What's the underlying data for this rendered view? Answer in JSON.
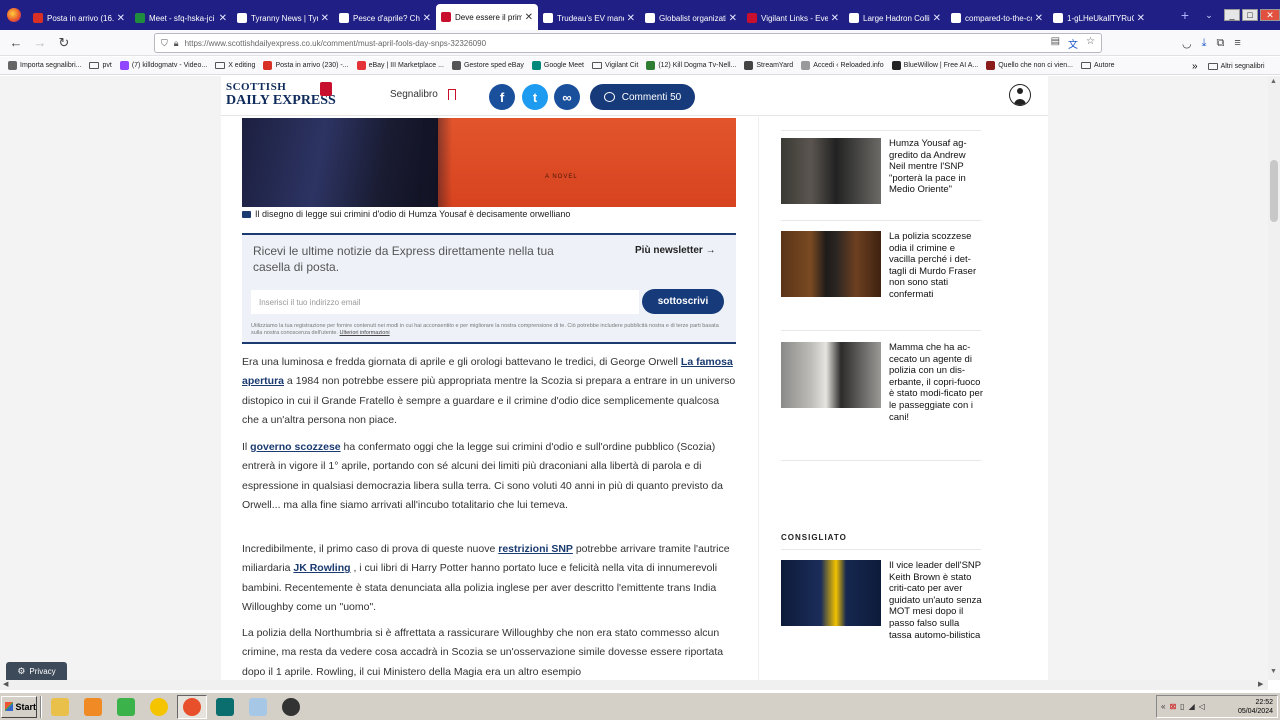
{
  "tabs": [
    {
      "label": "Posta in arrivo (16...)",
      "color": "#d93025"
    },
    {
      "label": "Meet - sfq-hska-jci",
      "color": "#1e8e3e"
    },
    {
      "label": "Tyranny News | Tyranny",
      "color": "#ffffff"
    },
    {
      "label": "Pesce d'aprile? Chiamare",
      "color": "#ffffff"
    },
    {
      "label": "Deve essere il primo",
      "color": "#c8102e",
      "active": true
    },
    {
      "label": "Trudeau's EV mandate c",
      "color": "#ffffff"
    },
    {
      "label": "Globalist organizations a",
      "color": "#ffffff"
    },
    {
      "label": "Vigilant Links - Ever",
      "color": "#c8102e"
    },
    {
      "label": "Large Hadron Collid",
      "color": "#ffffff"
    },
    {
      "label": "compared-to-the-collid",
      "color": "#ffffff"
    },
    {
      "label": "1-gLHeUkallTYRuQIpPal",
      "color": "#ffffff"
    }
  ],
  "window_controls": {
    "minimize": "_",
    "maximize": "□",
    "close": "✕"
  },
  "nav": {
    "url": "https://www.scottishdailyexpress.co.uk/comment/must-april-fools-day-snps-32326090"
  },
  "bookmarks": [
    {
      "label": "Importa segnalibri...",
      "icon": "import-icon",
      "color": "#666666"
    },
    {
      "label": "pvt",
      "icon": "folder-icon"
    },
    {
      "label": "(7) killdogmatv - Video...",
      "icon": "twitch-icon",
      "color": "#9146ff"
    },
    {
      "label": "X editing",
      "icon": "folder-icon"
    },
    {
      "label": "Posta in arrivo (230) -...",
      "icon": "gmail-icon",
      "color": "#d93025"
    },
    {
      "label": "eBay | III Marketplace ...",
      "icon": "ebay-icon",
      "color": "#e53238"
    },
    {
      "label": "Gestore sped eBay",
      "icon": "globe-icon",
      "color": "#555555"
    },
    {
      "label": "Google Meet",
      "icon": "meet-icon",
      "color": "#00897b"
    },
    {
      "label": "Vigilant Cit",
      "icon": "folder-icon"
    },
    {
      "label": "(12) Kill Dogma Tv-Nell...",
      "icon": "youtube-icon",
      "color": "#2e7d32"
    },
    {
      "label": "StreamYard",
      "icon": "streamyard-icon",
      "color": "#444444"
    },
    {
      "label": "Accedi ‹ Reloaded.info",
      "icon": "doc-icon",
      "color": "#999999"
    },
    {
      "label": "BlueWillow | Free AI A...",
      "icon": "bluewillow-icon",
      "color": "#222222"
    },
    {
      "label": "Quello che non ci vien...",
      "icon": "site-icon",
      "color": "#8b1a1a"
    },
    {
      "label": "Autore",
      "icon": "folder-icon"
    }
  ],
  "bookmarks_other": "Altri segnalibri",
  "site": {
    "logo_line1": "SCOTTISH",
    "logo_line2": "DAILY EXPRESS",
    "bookmark_label": "Segnalibro",
    "comments_label": "Commenti 50",
    "share_facebook": "f",
    "share_twitter": "t",
    "share_link": "∞"
  },
  "article": {
    "hero_novel_text": "A NOVEL",
    "caption": "Il disegno di legge sui crimini d'odio di Humza Yousaf è decisamente orwelliano",
    "newsletter": {
      "title": "Ricevi le ultime notizie da Express direttamente nella tua casella di posta.",
      "more": "Più newsletter",
      "placeholder": "Inserisci il tuo indirizzo email",
      "submit": "sottoscrivi",
      "legal": "Utilizziamo la tua registrazione per fornire contenuti nei modi in cui hai acconsentito e per migliorare la nostra comprensione di te. Ciò potrebbe includere pubblicità nostra e di terze parti basata sulla nostra conoscenza dell'utente.",
      "legal_link": "Ulteriori informazioni"
    },
    "p1": {
      "a": "Era una luminosa e fredda giornata di aprile e gli orologi battevano le tredici, di George Orwell ",
      "link": "La famosa apertura",
      "b": " a 1984 non potrebbe essere più appropriata mentre la Scozia si prepara a entrare in un universo distopico in cui il Grande Fratello è sempre a guardare e il crimine d'odio dice semplicemente qualcosa che a un'altra persona non piace."
    },
    "p2": {
      "a": "Il ",
      "link": "governo scozzese",
      "b": " ha confermato oggi che la legge sui crimini d'odio e sull'ordine pubblico (Scozia) entrerà in vigore il 1° aprile, portando con sé alcuni dei limiti più draconiani alla libertà di parola e di espressione in qualsiasi democrazia libera sulla terra. Ci sono voluti 40 anni in più di quanto previsto da Orwell... ma alla fine siamo arrivati all'incubo totalitario che lui temeva."
    },
    "p3": {
      "a": "Incredibilmente, il primo caso di prova di queste nuove ",
      "link1": "restrizioni SNP",
      "b": " potrebbe arrivare tramite l'autrice miliardaria ",
      "link2": "JK Rowling",
      "c": " , i cui libri di Harry Potter hanno portato luce e felicità nella vita di innumerevoli bambini. Recentemente è stata denunciata alla polizia inglese per aver descritto l'emittente trans India Willoughby come un \"uomo\"."
    },
    "p4": "La polizia della Northumbria si è affrettata a rassicurare Willoughby che non era stato commesso alcun crimine, ma resta da vedere cosa accadrà in Scozia se un'osservazione simile dovesse essere riportata dopo il 1 aprile. Rowling, il cui Ministero della Magia era un altro esempio"
  },
  "sidebar": {
    "items": [
      {
        "text": "Humza Yousaf ag-gredito da Andrew Neil mentre l'SNP \"porterà la pace in Medio Oriente\""
      },
      {
        "text": "La polizia scozzese odia il crimine e vacilla perché i det-tagli di Murdo Fraser non sono stati confermati"
      },
      {
        "text": "Mamma che ha ac-cecato un agente di polizia con un dis-erbante, il copri-fuoco è stato modi-ficato per le passeggiate con i cani!"
      }
    ],
    "recommended_label": "CONSIGLIATO",
    "recommended": [
      {
        "text": "Il vice leader dell'SNP Keith Brown è stato criti-cato per aver guidato un'auto senza MOT mesi dopo il passo falso sulla tassa automo-bilistica"
      }
    ]
  },
  "privacy_label": "Privacy",
  "taskbar": {
    "start_label": "Start",
    "apps": [
      {
        "name": "file-manager-icon",
        "color": "#e8c04a"
      },
      {
        "name": "media-player-icon",
        "color": "#f08a24"
      },
      {
        "name": "color-picker-icon",
        "color": "#3bb34a"
      },
      {
        "name": "paint-icon",
        "color": "#f5c400"
      },
      {
        "name": "firefox-icon",
        "color": "#e8502b"
      },
      {
        "name": "terminal-icon",
        "color": "#0a6e6e"
      },
      {
        "name": "notepad-icon",
        "color": "#a6c8e6"
      },
      {
        "name": "obs-icon",
        "color": "#333333"
      }
    ],
    "clock_time": "22:52",
    "clock_date": "05/04/2024"
  }
}
